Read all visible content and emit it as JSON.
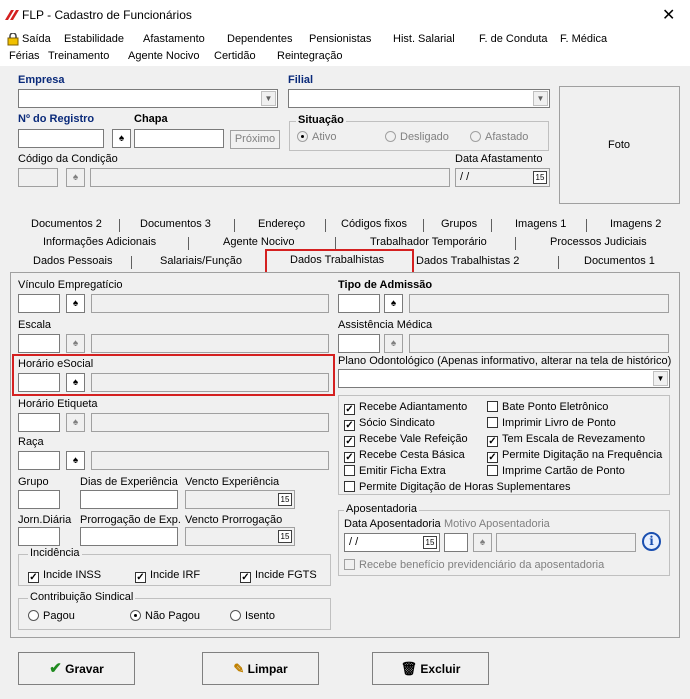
{
  "window": {
    "title": "FLP - Cadastro de Funcionários",
    "close": "✕"
  },
  "menu": {
    "row1": [
      "Saída",
      "Estabilidade",
      "Afastamento",
      "Dependentes",
      "Pensionistas",
      "Hist. Salarial",
      "F. de Conduta",
      "F. Médica"
    ],
    "row2": [
      "Férias",
      "Treinamento",
      "Agente Nocivo",
      "Certidão",
      "Reintegração"
    ]
  },
  "header": {
    "empresa_label": "Empresa",
    "filial_label": "Filial",
    "registro_label": "Nº do Registro",
    "chapa_label": "Chapa",
    "proximo": "Próximo",
    "situacao_label": "Situação",
    "situacao_options": [
      "Ativo",
      "Desligado",
      "Afastado"
    ],
    "codigo_condicao_label": "Código da Condição",
    "data_afastamento_label": "Data Afastamento",
    "data_afastamento_value": " / /",
    "foto": "Foto"
  },
  "tabs": {
    "row1": [
      "Documentos 2",
      "Documentos 3",
      "Endereço",
      "Códigos fixos",
      "Grupos",
      "Imagens 1",
      "Imagens 2"
    ],
    "row2": [
      "Informações Adicionais",
      "Agente Nocivo",
      "Trabalhador Temporário",
      "Processos Judiciais"
    ],
    "row3": [
      "Dados Pessoais",
      "Salariais/Função",
      "Dados Trabalhistas",
      "Dados Trabalhistas 2",
      "Documentos 1"
    ]
  },
  "form": {
    "vinculo": "Vínculo Empregatício",
    "escala": "Escala",
    "horario_esocial": "Horário eSocial",
    "horario_etiqueta": "Horário Etiqueta",
    "raca": "Raça",
    "grupo": "Grupo",
    "dias_experiencia": "Dias de Experiência",
    "vencto_experiencia": "Vencto Experiência",
    "jorn_diaria": "Jorn.Diária",
    "prorrogacao": "Prorrogação de Exp.",
    "vencto_prorrogacao": "Vencto Prorrogação",
    "tipo_admissao": "Tipo de Admissão",
    "assistencia_medica": "Assistência Médica",
    "plano_odonto": "Plano Odontológico (Apenas informativo, alterar na tela de histórico)"
  },
  "checks_left": [
    {
      "label": "Recebe Adiantamento",
      "checked": true
    },
    {
      "label": "Sócio Sindicato",
      "checked": true
    },
    {
      "label": "Recebe Vale Refeição",
      "checked": true
    },
    {
      "label": "Recebe Cesta Básica",
      "checked": true
    },
    {
      "label": "Emitir Ficha Extra",
      "checked": false
    }
  ],
  "checks_right": [
    {
      "label": "Bate Ponto Eletrônico",
      "checked": false
    },
    {
      "label": "Imprimir Livro de Ponto",
      "checked": false
    },
    {
      "label": "Tem Escala de Revezamento",
      "checked": true
    },
    {
      "label": "Permite Digitação na Frequência",
      "checked": true
    },
    {
      "label": "Imprime Cartão de Ponto",
      "checked": false
    }
  ],
  "check_full": {
    "label": "Permite Digitação de Horas Suplementares",
    "checked": false
  },
  "aposentadoria": {
    "title": "Aposentadoria",
    "data_label": "Data Aposentadoria",
    "motivo_label": "Motivo Aposentadoria",
    "data_value": " / /",
    "beneficio": "Recebe benefício previdenciário da aposentadoria"
  },
  "incidencia": {
    "title": "Incidência",
    "items": [
      {
        "label": "Incide INSS",
        "checked": true
      },
      {
        "label": "Incide IRF",
        "checked": true
      },
      {
        "label": "Incide FGTS",
        "checked": true
      }
    ]
  },
  "contribuicao": {
    "title": "Contribuição Sindical",
    "options": [
      {
        "label": "Pagou",
        "selected": false
      },
      {
        "label": "Não Pagou",
        "selected": true
      },
      {
        "label": "Isento",
        "selected": false
      }
    ]
  },
  "buttons": {
    "gravar": "Gravar",
    "limpar": "Limpar",
    "excluir": "Excluir"
  },
  "accent": {
    "highlight": "#d42020",
    "label_blue": "#0a2a7a"
  }
}
